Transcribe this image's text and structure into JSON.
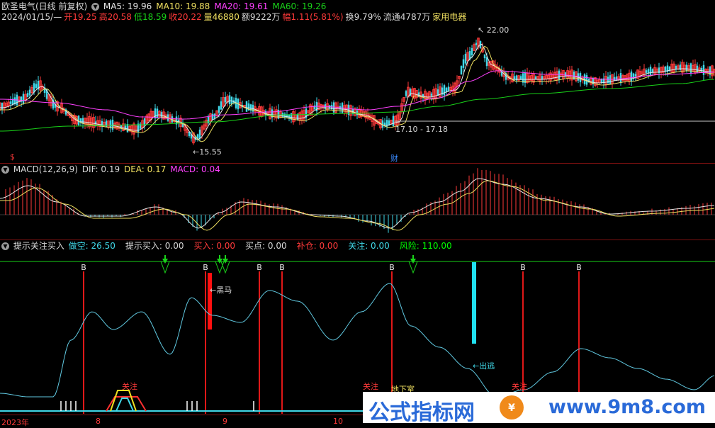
{
  "header": {
    "title": "欧圣电气(日线 前复权)",
    "ma": [
      {
        "label": "MA5: 19.96",
        "color": "#e8e8e8"
      },
      {
        "label": "MA10: 19.88",
        "color": "#f0e060"
      },
      {
        "label": "MA20: 19.61",
        "color": "#ff40ff"
      },
      {
        "label": "MA60: 19.26",
        "color": "#19d219"
      }
    ],
    "info": [
      {
        "t": "2024/01/15/—",
        "c": "cw"
      },
      {
        "t": "开19.25",
        "c": "cr"
      },
      {
        "t": "高20.58",
        "c": "cr"
      },
      {
        "t": "低18.59",
        "c": "cg"
      },
      {
        "t": "收20.22",
        "c": "cr"
      },
      {
        "t": "量46880",
        "c": "cy"
      },
      {
        "t": "额9222万",
        "c": "cw"
      },
      {
        "t": "幅1.11(5.81%)",
        "c": "cr"
      },
      {
        "t": "换9.79%",
        "c": "cw"
      },
      {
        "t": "流通4787万",
        "c": "cw"
      },
      {
        "t": "家用电器",
        "c": "cy"
      }
    ]
  },
  "price_annotations": {
    "high": "22.00",
    "low": "15.55",
    "range": "17.10 - 17.18",
    "finance_tag": "财",
    "s_tag": "$"
  },
  "macd": {
    "title": "MACD(12,26,9)",
    "dif": "DIF: 0.19",
    "dea": "DEA: 0.17",
    "macd": "MACD: 0.04"
  },
  "signal": {
    "title": "提示关注买入",
    "items": [
      {
        "t": "做空: 26.50",
        "c": "cc"
      },
      {
        "t": "提示买入: 0.00",
        "c": "cw"
      },
      {
        "t": "买入: 0.00",
        "c": "cr"
      },
      {
        "t": "买点: 0.00",
        "c": "cw"
      },
      {
        "t": "补仓: 0.00",
        "c": "cr"
      },
      {
        "t": "关注: 0.00",
        "c": "cc"
      },
      {
        "t": "风险: 110.00",
        "c": "cgg"
      }
    ],
    "b_mark": "B",
    "heima": "←黑马",
    "chutao": "←出逃",
    "guanzhu": "关注",
    "dixia": "地下室"
  },
  "xaxis": {
    "labels": [
      "2023年",
      "8",
      "9",
      "10"
    ]
  },
  "watermark": {
    "text": "公式指标网",
    "url": "www.9m8.com"
  },
  "colors": {
    "up": "#ff3a3a",
    "down": "#40d8e8",
    "ma5": "#e8e8e8",
    "ma10": "#f0e060",
    "ma20": "#ff40ff",
    "ma60": "#19d219"
  }
}
